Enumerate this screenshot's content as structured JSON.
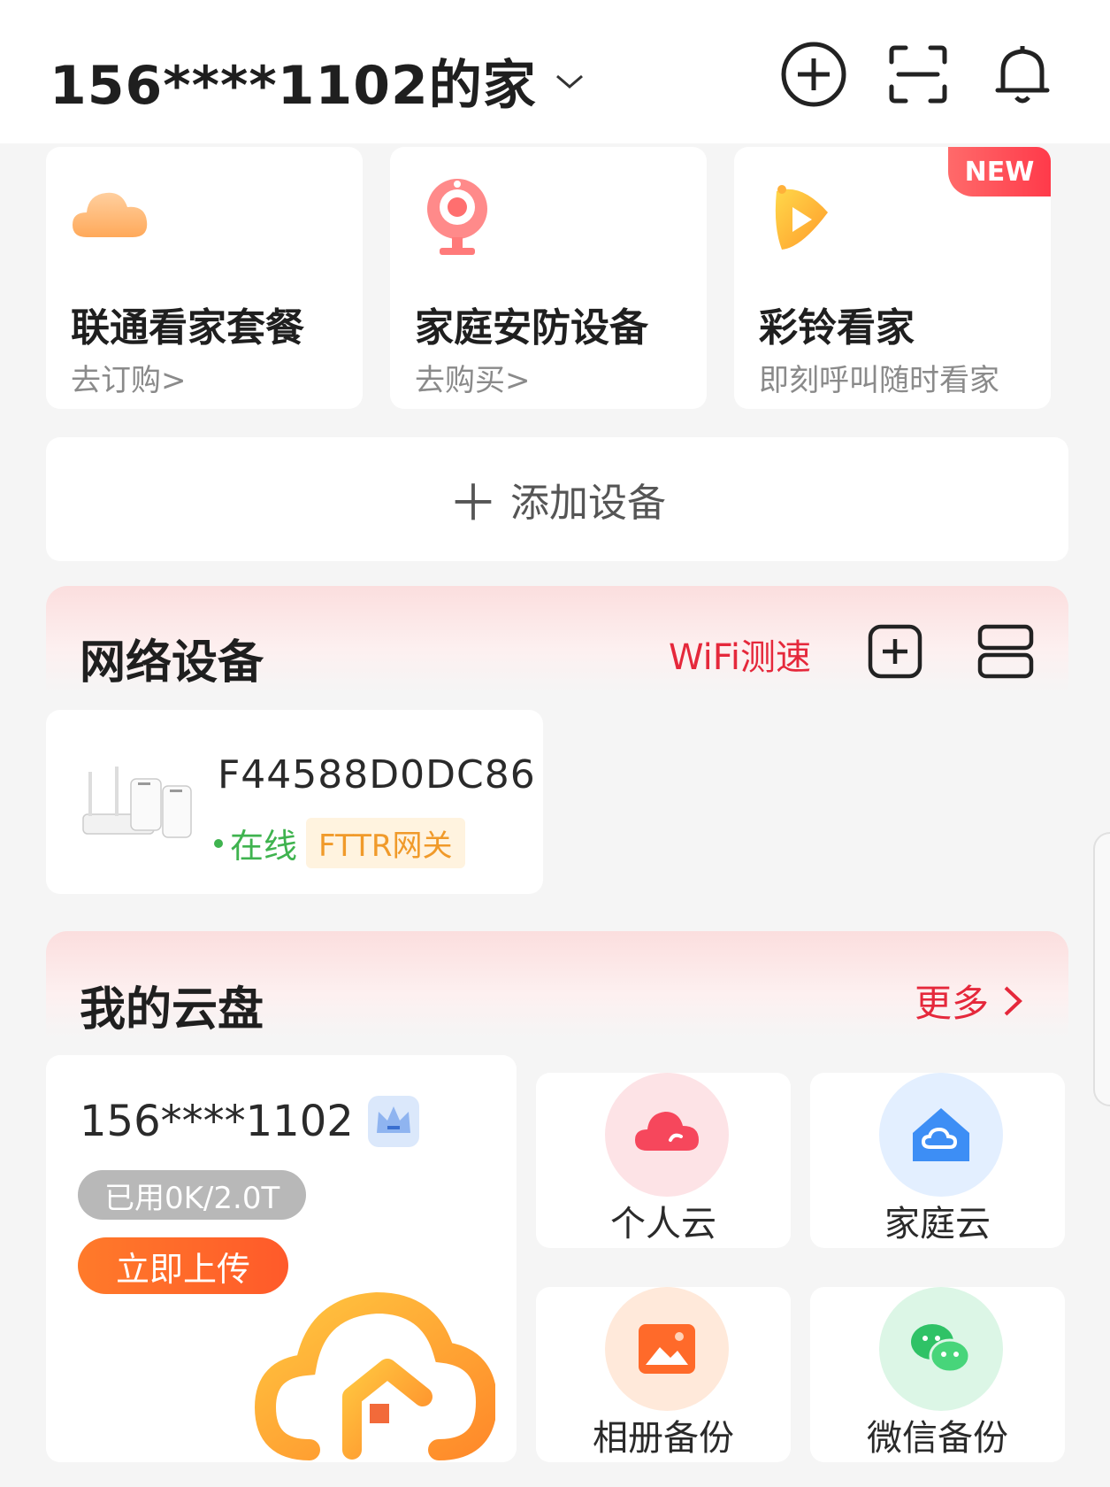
{
  "header": {
    "home_name": "156****1102的家"
  },
  "services": [
    {
      "title": "联通看家套餐",
      "subtitle": "去订购>"
    },
    {
      "title": "家庭安防设备",
      "subtitle": "去购买>"
    },
    {
      "title": "彩铃看家",
      "subtitle": "即刻呼叫随时看家",
      "badge": "NEW"
    }
  ],
  "add_device": {
    "label": "添加设备"
  },
  "network": {
    "title": "网络设备",
    "speedtest": "WiFi测速",
    "device": {
      "name": "F44588D0DC86",
      "status": "在线",
      "type": "FTTR网关"
    }
  },
  "cloud": {
    "title": "我的云盘",
    "more": "更多",
    "account": "156****1102",
    "usage": "已用0K/2.0T",
    "upload": "立即上传",
    "tiles": [
      {
        "label": "个人云"
      },
      {
        "label": "家庭云"
      },
      {
        "label": "相册备份"
      },
      {
        "label": "微信备份"
      }
    ]
  },
  "colors": {
    "accent_red": "#e5283b",
    "online_green": "#3fb34f",
    "upload_orange": "#ff6a2a"
  }
}
